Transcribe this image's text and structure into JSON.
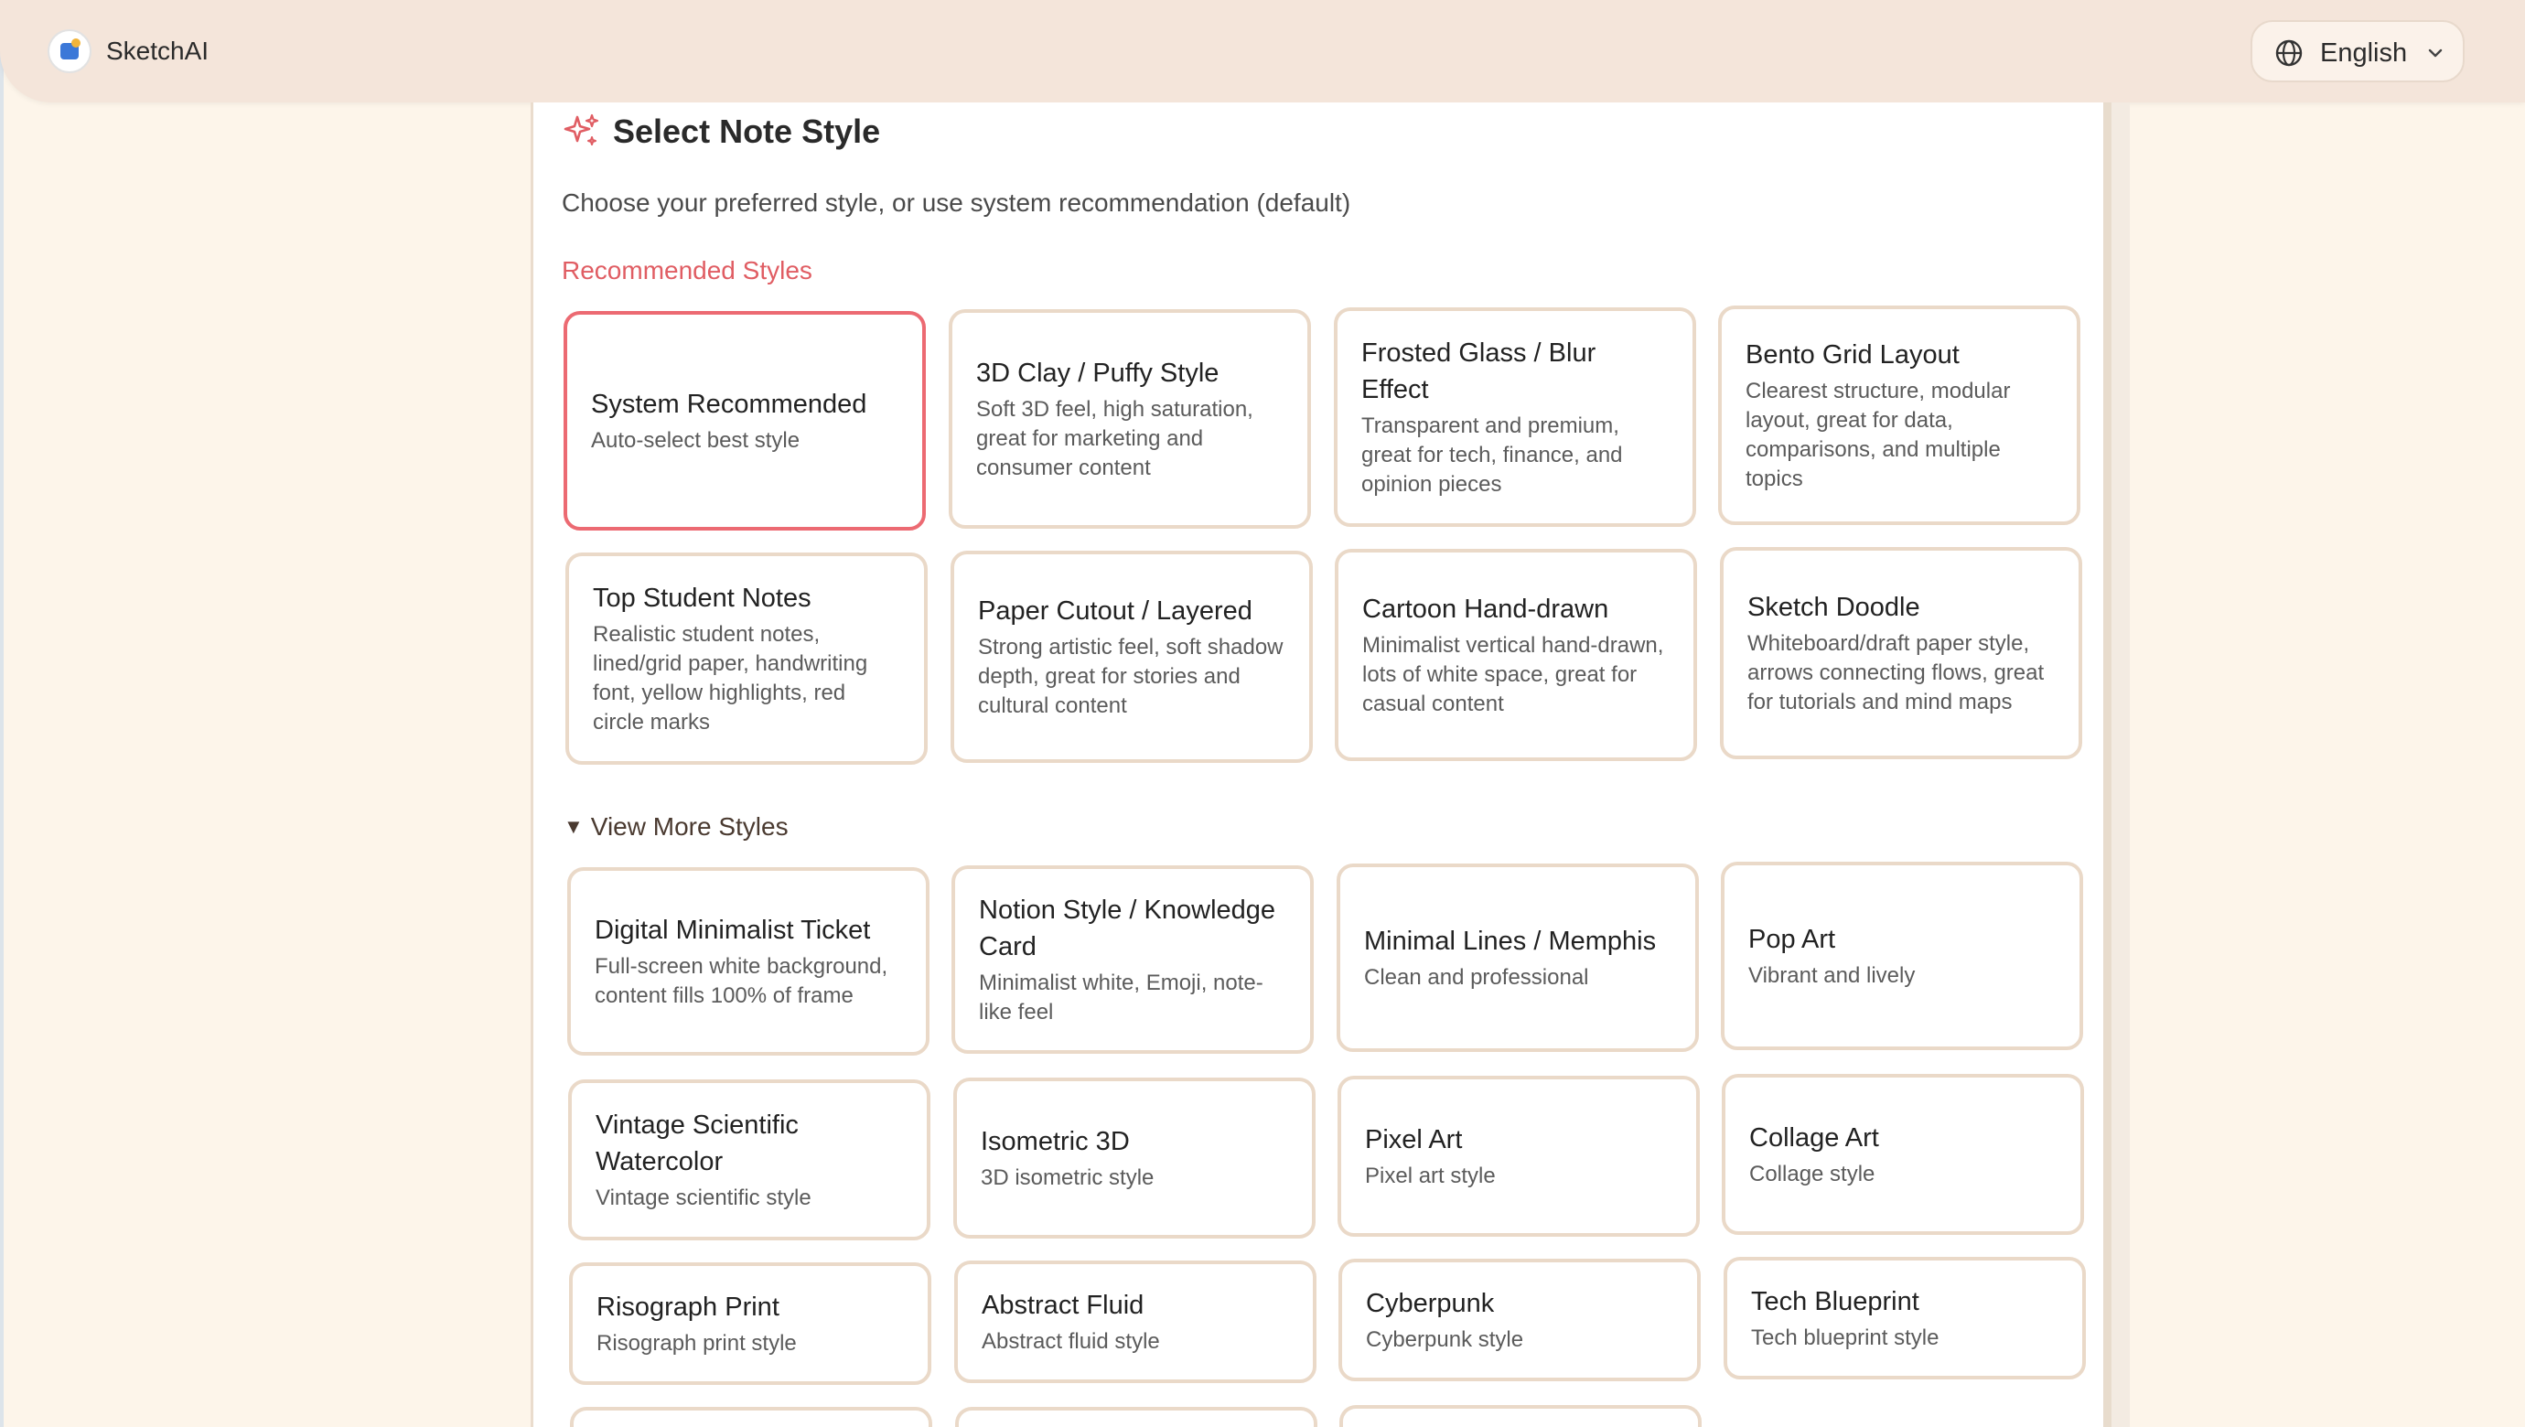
{
  "app": {
    "name": "SketchAI"
  },
  "language": {
    "current": "English"
  },
  "page": {
    "title": "Select Note Style",
    "subtitle": "Choose your preferred style, or use system recommendation (default)",
    "recommended_heading": "Recommended Styles",
    "more_heading": "View More Styles"
  },
  "recommended": [
    {
      "title": "System Recommended",
      "desc": "Auto-select best style",
      "selected": true
    },
    {
      "title": "3D Clay / Puffy Style",
      "desc": "Soft 3D feel, high saturation, great for marketing and consumer content"
    },
    {
      "title": "Frosted Glass / Blur Effect",
      "desc": "Transparent and premium, great for tech, finance, and opinion pieces"
    },
    {
      "title": "Bento Grid Layout",
      "desc": "Clearest structure, modular layout, great for data, comparisons, and multiple topics"
    },
    {
      "title": "Top Student Notes",
      "desc": "Realistic student notes, lined/grid paper, handwriting font, yellow highlights, red circle marks"
    },
    {
      "title": "Paper Cutout / Layered",
      "desc": "Strong artistic feel, soft shadow depth, great for stories and cultural content"
    },
    {
      "title": "Cartoon Hand-drawn",
      "desc": "Minimalist vertical hand-drawn, lots of white space, great for casual content"
    },
    {
      "title": "Sketch Doodle",
      "desc": "Whiteboard/draft paper style, arrows connecting flows, great for tutorials and mind maps"
    }
  ],
  "more": [
    {
      "title": "Digital Minimalist Ticket",
      "desc": "Full-screen white background, content fills 100% of frame"
    },
    {
      "title": "Notion Style / Knowledge Card",
      "desc": "Minimalist white, Emoji, note-like feel"
    },
    {
      "title": "Minimal Lines / Memphis",
      "desc": "Clean and professional"
    },
    {
      "title": "Pop Art",
      "desc": "Vibrant and lively"
    },
    {
      "title": "Vintage Scientific Watercolor",
      "desc": "Vintage scientific style"
    },
    {
      "title": "Isometric 3D",
      "desc": "3D isometric style"
    },
    {
      "title": "Pixel Art",
      "desc": "Pixel art style"
    },
    {
      "title": "Collage Art",
      "desc": "Collage style"
    },
    {
      "title": "Risograph Print",
      "desc": "Risograph print style"
    },
    {
      "title": "Abstract Fluid",
      "desc": "Abstract fluid style"
    },
    {
      "title": "Cyberpunk",
      "desc": "Cyberpunk style"
    },
    {
      "title": "Tech Blueprint",
      "desc": "Tech blueprint style"
    },
    {
      "title": "",
      "desc": ""
    },
    {
      "title": "",
      "desc": ""
    },
    {
      "title": "",
      "desc": ""
    }
  ],
  "colors": {
    "accent": "#e05d63",
    "card_border": "#ead9c8",
    "topbar": "#f4e5da",
    "background": "#fdf5ea"
  },
  "icons": {
    "logo": "sketchai-logo",
    "language": "globe-icon",
    "dropdown": "chevron-down-icon",
    "title": "sparkle-icon",
    "more_toggle": "triangle-down-icon"
  }
}
